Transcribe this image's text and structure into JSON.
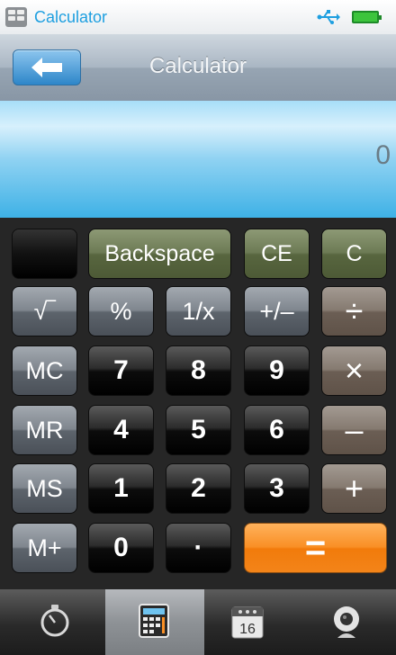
{
  "status_bar": {
    "app_title": "Calculator",
    "icons": [
      "app-icon",
      "usb-icon",
      "battery-icon"
    ]
  },
  "title_bar": {
    "title": "Calculator",
    "back_icon": "arrow-left-icon"
  },
  "display": {
    "value": "0"
  },
  "keys": {
    "memory_indicator": "",
    "backspace": "Backspace",
    "ce": "CE",
    "c": "C",
    "sqrt": "√‾",
    "percent": "%",
    "reciprocal": "1/x",
    "sign": "+/–",
    "divide": "÷",
    "mc": "MC",
    "seven": "7",
    "eight": "8",
    "nine": "9",
    "multiply": "×",
    "mr": "MR",
    "four": "4",
    "five": "5",
    "six": "6",
    "minus": "–",
    "ms": "MS",
    "one": "1",
    "two": "2",
    "three": "3",
    "plus": "+",
    "mplus": "M+",
    "zero": "0",
    "dot": "·",
    "equals": "="
  },
  "tab_bar": {
    "tabs": [
      {
        "icon": "stopwatch-icon",
        "active": false
      },
      {
        "icon": "calculator-icon",
        "active": true
      },
      {
        "icon": "calendar-icon",
        "active": false,
        "label": "16"
      },
      {
        "icon": "webcam-icon",
        "active": false
      }
    ]
  },
  "colors": {
    "accent_blue": "#1e9fe0",
    "display_blue": "#3eb1e6",
    "equals_orange": "#f98f25",
    "keypad_bg": "#262626"
  }
}
